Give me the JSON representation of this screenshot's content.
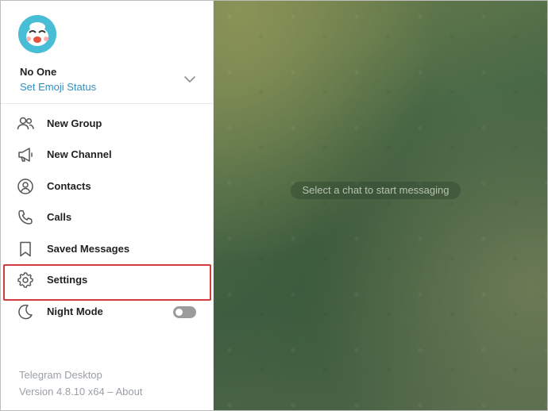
{
  "user": {
    "name": "No One",
    "status_action": "Set Emoji Status"
  },
  "menu": {
    "items": [
      {
        "label": "New Group",
        "icon": "group-icon"
      },
      {
        "label": "New Channel",
        "icon": "megaphone-icon"
      },
      {
        "label": "Contacts",
        "icon": "contact-icon"
      },
      {
        "label": "Calls",
        "icon": "phone-icon"
      },
      {
        "label": "Saved Messages",
        "icon": "bookmark-icon"
      },
      {
        "label": "Settings",
        "icon": "gear-icon"
      },
      {
        "label": "Night Mode",
        "icon": "moon-icon"
      }
    ],
    "night_mode_enabled": false
  },
  "footer": {
    "app_name": "Telegram Desktop",
    "version": "Version 4.8.10 x64 – ",
    "about_link": "About"
  },
  "chat": {
    "empty_text": "Select a chat to start messaging"
  },
  "colors": {
    "accent": "#3390c4",
    "highlight": "#d43a3a"
  }
}
